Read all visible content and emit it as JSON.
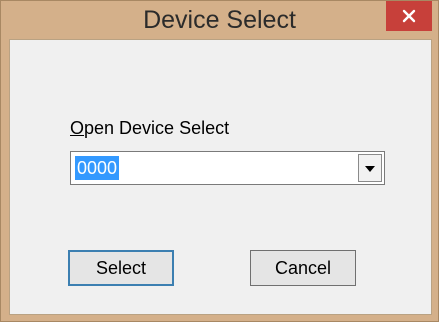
{
  "window": {
    "title": "Device Select",
    "close_icon": "close-icon"
  },
  "dialog": {
    "label_underlined": "O",
    "label_rest": "pen Device Select",
    "combo_value": "0000",
    "combo_arrow_icon": "chevron-down-icon"
  },
  "buttons": {
    "select_label": "Select",
    "cancel_label": "Cancel"
  },
  "colors": {
    "frame": "#d4b08a",
    "close": "#c7403a",
    "selection": "#3399ff",
    "client": "#f0f0f0"
  }
}
